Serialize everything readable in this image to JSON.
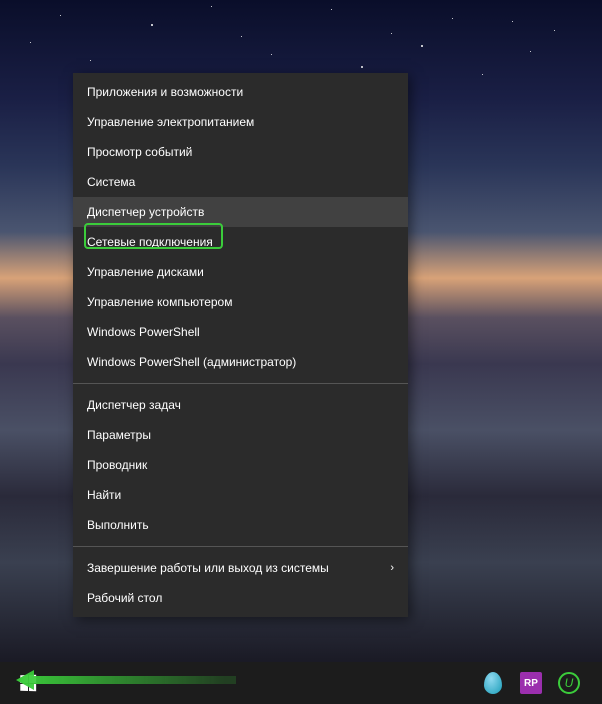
{
  "menu": {
    "sections": [
      {
        "items": [
          {
            "label": "Приложения и возможности",
            "highlighted": false,
            "submenu": false
          },
          {
            "label": "Управление электропитанием",
            "highlighted": false,
            "submenu": false
          },
          {
            "label": "Просмотр событий",
            "highlighted": false,
            "submenu": false
          },
          {
            "label": "Система",
            "highlighted": false,
            "submenu": false
          },
          {
            "label": "Диспетчер устройств",
            "highlighted": true,
            "submenu": false
          },
          {
            "label": "Сетевые подключения",
            "highlighted": false,
            "submenu": false
          },
          {
            "label": "Управление дисками",
            "highlighted": false,
            "submenu": false
          },
          {
            "label": "Управление компьютером",
            "highlighted": false,
            "submenu": false
          },
          {
            "label": "Windows PowerShell",
            "highlighted": false,
            "submenu": false
          },
          {
            "label": "Windows PowerShell (администратор)",
            "highlighted": false,
            "submenu": false
          }
        ]
      },
      {
        "items": [
          {
            "label": "Диспетчер задач",
            "highlighted": false,
            "submenu": false
          },
          {
            "label": "Параметры",
            "highlighted": false,
            "submenu": false
          },
          {
            "label": "Проводник",
            "highlighted": false,
            "submenu": false
          },
          {
            "label": "Найти",
            "highlighted": false,
            "submenu": false
          },
          {
            "label": "Выполнить",
            "highlighted": false,
            "submenu": false
          }
        ]
      },
      {
        "items": [
          {
            "label": "Завершение работы или выход из системы",
            "highlighted": false,
            "submenu": true
          },
          {
            "label": "Рабочий стол",
            "highlighted": false,
            "submenu": false
          }
        ]
      }
    ]
  },
  "tray": {
    "rp_label": "RP"
  },
  "annotation": {
    "highlight_color": "#3bcc3b",
    "arrow_color": "#3bcc3b"
  }
}
